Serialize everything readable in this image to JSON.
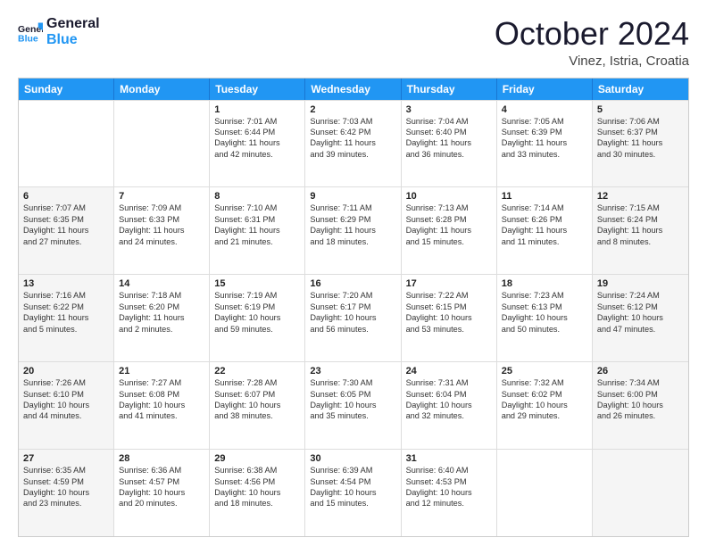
{
  "header": {
    "logo_general": "General",
    "logo_blue": "Blue",
    "month": "October 2024",
    "location": "Vinez, Istria, Croatia"
  },
  "days_of_week": [
    "Sunday",
    "Monday",
    "Tuesday",
    "Wednesday",
    "Thursday",
    "Friday",
    "Saturday"
  ],
  "rows": [
    [
      {
        "day": "",
        "lines": [],
        "shaded": false
      },
      {
        "day": "",
        "lines": [],
        "shaded": false
      },
      {
        "day": "1",
        "lines": [
          "Sunrise: 7:01 AM",
          "Sunset: 6:44 PM",
          "Daylight: 11 hours",
          "and 42 minutes."
        ],
        "shaded": false
      },
      {
        "day": "2",
        "lines": [
          "Sunrise: 7:03 AM",
          "Sunset: 6:42 PM",
          "Daylight: 11 hours",
          "and 39 minutes."
        ],
        "shaded": false
      },
      {
        "day": "3",
        "lines": [
          "Sunrise: 7:04 AM",
          "Sunset: 6:40 PM",
          "Daylight: 11 hours",
          "and 36 minutes."
        ],
        "shaded": false
      },
      {
        "day": "4",
        "lines": [
          "Sunrise: 7:05 AM",
          "Sunset: 6:39 PM",
          "Daylight: 11 hours",
          "and 33 minutes."
        ],
        "shaded": false
      },
      {
        "day": "5",
        "lines": [
          "Sunrise: 7:06 AM",
          "Sunset: 6:37 PM",
          "Daylight: 11 hours",
          "and 30 minutes."
        ],
        "shaded": true
      }
    ],
    [
      {
        "day": "6",
        "lines": [
          "Sunrise: 7:07 AM",
          "Sunset: 6:35 PM",
          "Daylight: 11 hours",
          "and 27 minutes."
        ],
        "shaded": true
      },
      {
        "day": "7",
        "lines": [
          "Sunrise: 7:09 AM",
          "Sunset: 6:33 PM",
          "Daylight: 11 hours",
          "and 24 minutes."
        ],
        "shaded": false
      },
      {
        "day": "8",
        "lines": [
          "Sunrise: 7:10 AM",
          "Sunset: 6:31 PM",
          "Daylight: 11 hours",
          "and 21 minutes."
        ],
        "shaded": false
      },
      {
        "day": "9",
        "lines": [
          "Sunrise: 7:11 AM",
          "Sunset: 6:29 PM",
          "Daylight: 11 hours",
          "and 18 minutes."
        ],
        "shaded": false
      },
      {
        "day": "10",
        "lines": [
          "Sunrise: 7:13 AM",
          "Sunset: 6:28 PM",
          "Daylight: 11 hours",
          "and 15 minutes."
        ],
        "shaded": false
      },
      {
        "day": "11",
        "lines": [
          "Sunrise: 7:14 AM",
          "Sunset: 6:26 PM",
          "Daylight: 11 hours",
          "and 11 minutes."
        ],
        "shaded": false
      },
      {
        "day": "12",
        "lines": [
          "Sunrise: 7:15 AM",
          "Sunset: 6:24 PM",
          "Daylight: 11 hours",
          "and 8 minutes."
        ],
        "shaded": true
      }
    ],
    [
      {
        "day": "13",
        "lines": [
          "Sunrise: 7:16 AM",
          "Sunset: 6:22 PM",
          "Daylight: 11 hours",
          "and 5 minutes."
        ],
        "shaded": true
      },
      {
        "day": "14",
        "lines": [
          "Sunrise: 7:18 AM",
          "Sunset: 6:20 PM",
          "Daylight: 11 hours",
          "and 2 minutes."
        ],
        "shaded": false
      },
      {
        "day": "15",
        "lines": [
          "Sunrise: 7:19 AM",
          "Sunset: 6:19 PM",
          "Daylight: 10 hours",
          "and 59 minutes."
        ],
        "shaded": false
      },
      {
        "day": "16",
        "lines": [
          "Sunrise: 7:20 AM",
          "Sunset: 6:17 PM",
          "Daylight: 10 hours",
          "and 56 minutes."
        ],
        "shaded": false
      },
      {
        "day": "17",
        "lines": [
          "Sunrise: 7:22 AM",
          "Sunset: 6:15 PM",
          "Daylight: 10 hours",
          "and 53 minutes."
        ],
        "shaded": false
      },
      {
        "day": "18",
        "lines": [
          "Sunrise: 7:23 AM",
          "Sunset: 6:13 PM",
          "Daylight: 10 hours",
          "and 50 minutes."
        ],
        "shaded": false
      },
      {
        "day": "19",
        "lines": [
          "Sunrise: 7:24 AM",
          "Sunset: 6:12 PM",
          "Daylight: 10 hours",
          "and 47 minutes."
        ],
        "shaded": true
      }
    ],
    [
      {
        "day": "20",
        "lines": [
          "Sunrise: 7:26 AM",
          "Sunset: 6:10 PM",
          "Daylight: 10 hours",
          "and 44 minutes."
        ],
        "shaded": true
      },
      {
        "day": "21",
        "lines": [
          "Sunrise: 7:27 AM",
          "Sunset: 6:08 PM",
          "Daylight: 10 hours",
          "and 41 minutes."
        ],
        "shaded": false
      },
      {
        "day": "22",
        "lines": [
          "Sunrise: 7:28 AM",
          "Sunset: 6:07 PM",
          "Daylight: 10 hours",
          "and 38 minutes."
        ],
        "shaded": false
      },
      {
        "day": "23",
        "lines": [
          "Sunrise: 7:30 AM",
          "Sunset: 6:05 PM",
          "Daylight: 10 hours",
          "and 35 minutes."
        ],
        "shaded": false
      },
      {
        "day": "24",
        "lines": [
          "Sunrise: 7:31 AM",
          "Sunset: 6:04 PM",
          "Daylight: 10 hours",
          "and 32 minutes."
        ],
        "shaded": false
      },
      {
        "day": "25",
        "lines": [
          "Sunrise: 7:32 AM",
          "Sunset: 6:02 PM",
          "Daylight: 10 hours",
          "and 29 minutes."
        ],
        "shaded": false
      },
      {
        "day": "26",
        "lines": [
          "Sunrise: 7:34 AM",
          "Sunset: 6:00 PM",
          "Daylight: 10 hours",
          "and 26 minutes."
        ],
        "shaded": true
      }
    ],
    [
      {
        "day": "27",
        "lines": [
          "Sunrise: 6:35 AM",
          "Sunset: 4:59 PM",
          "Daylight: 10 hours",
          "and 23 minutes."
        ],
        "shaded": true
      },
      {
        "day": "28",
        "lines": [
          "Sunrise: 6:36 AM",
          "Sunset: 4:57 PM",
          "Daylight: 10 hours",
          "and 20 minutes."
        ],
        "shaded": false
      },
      {
        "day": "29",
        "lines": [
          "Sunrise: 6:38 AM",
          "Sunset: 4:56 PM",
          "Daylight: 10 hours",
          "and 18 minutes."
        ],
        "shaded": false
      },
      {
        "day": "30",
        "lines": [
          "Sunrise: 6:39 AM",
          "Sunset: 4:54 PM",
          "Daylight: 10 hours",
          "and 15 minutes."
        ],
        "shaded": false
      },
      {
        "day": "31",
        "lines": [
          "Sunrise: 6:40 AM",
          "Sunset: 4:53 PM",
          "Daylight: 10 hours",
          "and 12 minutes."
        ],
        "shaded": false
      },
      {
        "day": "",
        "lines": [],
        "shaded": false
      },
      {
        "day": "",
        "lines": [],
        "shaded": true
      }
    ]
  ]
}
